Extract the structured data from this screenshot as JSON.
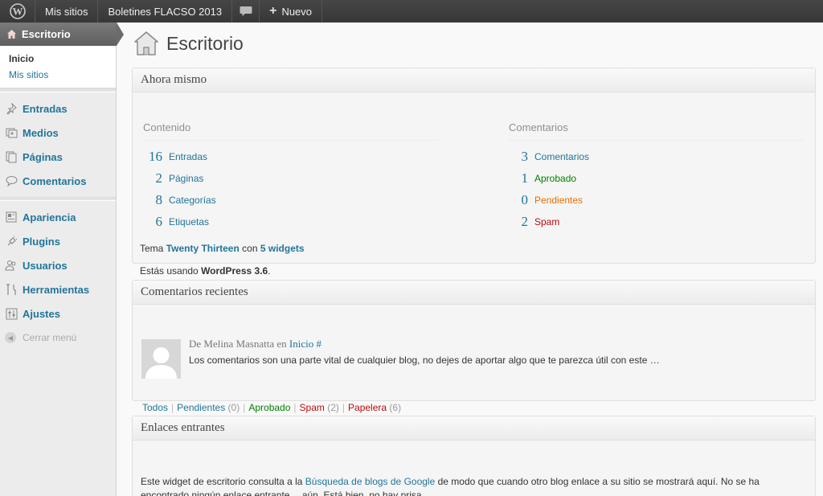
{
  "adminbar": {
    "wp_logo_icon": "wordpress-logo-icon",
    "my_sites": "Mis sitios",
    "site_name": "Boletines FLACSO 2013",
    "comments_icon": "speech-bubble-icon",
    "new_label": "Nuevo",
    "new_icon": "+"
  },
  "sidebar": {
    "current": {
      "label": "Escritorio",
      "icon": "home-icon"
    },
    "submenu": [
      {
        "label": "Inicio"
      },
      {
        "label": "Mis sitios"
      }
    ],
    "items": [
      {
        "label": "Entradas",
        "icon": "pushpin-icon"
      },
      {
        "label": "Medios",
        "icon": "media-icon"
      },
      {
        "label": "Páginas",
        "icon": "pages-icon"
      },
      {
        "label": "Comentarios",
        "icon": "comments-icon"
      },
      {
        "label": "Apariencia",
        "icon": "appearance-icon"
      },
      {
        "label": "Plugins",
        "icon": "plugin-icon"
      },
      {
        "label": "Usuarios",
        "icon": "users-icon"
      },
      {
        "label": "Herramientas",
        "icon": "tools-icon"
      },
      {
        "label": "Ajustes",
        "icon": "settings-icon"
      }
    ],
    "collapse": "Cerrar menú"
  },
  "main": {
    "title": "Escritorio",
    "title_icon": "house-icon",
    "right_now": {
      "title": "Ahora mismo",
      "content_head": "Contenido",
      "comments_head": "Comentarios",
      "content": [
        {
          "num": "16",
          "label": "Entradas"
        },
        {
          "num": "2",
          "label": "Páginas"
        },
        {
          "num": "8",
          "label": "Categorías"
        },
        {
          "num": "6",
          "label": "Etiquetas"
        }
      ],
      "comments": [
        {
          "num": "3",
          "label": "Comentarios",
          "color": "#21759b"
        },
        {
          "num": "1",
          "label": "Aprobado",
          "color": "#008000"
        },
        {
          "num": "0",
          "label": "Pendientes",
          "color": "#e66f00"
        },
        {
          "num": "2",
          "label": "Spam",
          "color": "#bc0b0b"
        }
      ],
      "theme_prefix": "Tema",
      "theme_name": "Twenty Thirteen",
      "theme_with": "con",
      "widgets": "5 widgets",
      "version_prefix": "Estás usando",
      "version": "WordPress 3.6",
      "version_suffix": "."
    },
    "recent_comments": {
      "title": "Comentarios recientes",
      "author_prefix": "De Melina Masnatta en",
      "post_link": "Inicio",
      "hash": "#",
      "excerpt": "Los comentarios son una parte vital de cualquier blog, no dejes de aportar algo que te parezca útil con este …",
      "links": {
        "all": "Todos",
        "pending": "Pendientes",
        "pending_count": "(0)",
        "approved": "Aprobado",
        "spam": "Spam",
        "spam_count": "(2)",
        "trash": "Papelera",
        "trash_count": "(6)",
        "sep": "|"
      }
    },
    "incoming_links": {
      "title": "Enlaces entrantes",
      "text_before": "Este widget de escritorio consulta a la",
      "link": "Búsqueda de blogs de Google",
      "text_after": "de modo que cuando otro blog enlace a su sitio se mostrará aquí. No se ha encontrado ningún enlace entrante… aún. Está bien, no hay prisa."
    }
  }
}
